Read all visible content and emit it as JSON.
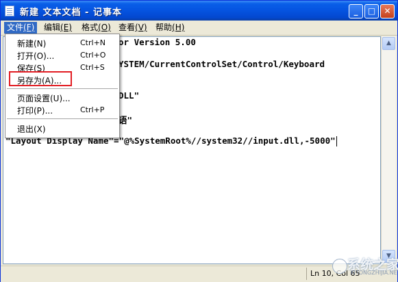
{
  "window": {
    "title": "新建 文本文档 - 记事本",
    "buttons": {
      "minimize": "_",
      "maximize": "□",
      "close": "✕"
    }
  },
  "menubar": {
    "items": [
      {
        "label": "文件",
        "mnemonic": "(F)"
      },
      {
        "label": "编辑",
        "mnemonic": "(E)"
      },
      {
        "label": "格式",
        "mnemonic": "(O)"
      },
      {
        "label": "查看",
        "mnemonic": "(V)"
      },
      {
        "label": "帮助",
        "mnemonic": "(H)"
      }
    ]
  },
  "file_menu": {
    "items": [
      {
        "label": "新建(N)",
        "shortcut": "Ctrl+N"
      },
      {
        "label": "打开(O)...",
        "shortcut": "Ctrl+O"
      },
      {
        "label": "保存(S)",
        "shortcut": "Ctrl+S"
      },
      {
        "label": "另存为(A)...",
        "shortcut": ""
      },
      {
        "label": "页面设置(U)...",
        "shortcut": ""
      },
      {
        "label": "打印(P)...",
        "shortcut": "Ctrl+P"
      },
      {
        "label": "退出(X)",
        "shortcut": ""
      }
    ]
  },
  "editor": {
    "lines": [
      "or Version 5.00",
      "YSTEM/CurrentControlSet/Control/Keyboard",
      "DLL\"",
      "语\"",
      "\"Layout Display Name\"=\"@%SystemRoot%//system32//input.dll,-5000\""
    ]
  },
  "statusbar": {
    "position": "Ln 10, Col 65"
  },
  "watermark": {
    "text": "系统之家",
    "sub": "XITONGZHIJIA.NET"
  },
  "colors": {
    "highlight_box": "#e21c22",
    "title_bar": "#0553e0",
    "menu_active": "#316ac5"
  }
}
